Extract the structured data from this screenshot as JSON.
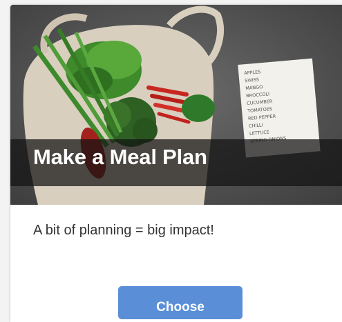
{
  "card": {
    "title": "Make a Meal Plan",
    "description": "A bit of planning = big impact!",
    "button_label": "Choose"
  },
  "shopping_list": {
    "items": [
      "APPLES",
      "SWISS",
      "MANGO",
      "BROCCOLI",
      "CUCUMBER",
      "TOMATOES",
      "RED PEPPER",
      "CHILLI",
      "LETTUCE",
      "SPRING ONIONS"
    ]
  },
  "colors": {
    "button": "#5a8fd8",
    "title_band": "#121212",
    "background": "#f3f3f3"
  }
}
